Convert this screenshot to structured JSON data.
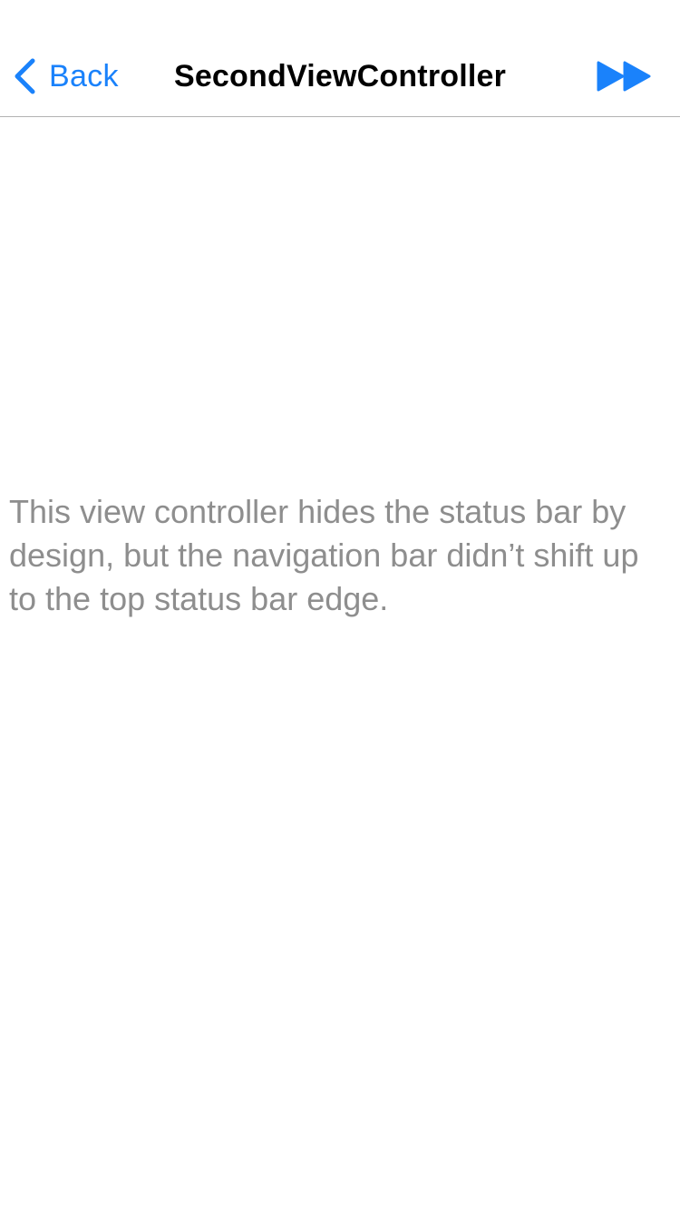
{
  "nav_bar": {
    "back_label": "Back",
    "title": "SecondViewController",
    "back_icon": "chevron-left-icon",
    "forward_icon": "fast-forward-icon",
    "accent_color": "#1a82fb"
  },
  "main": {
    "message": "This view controller hides the status bar by design, but the navigation bar didn’t shift up to the top status bar edge."
  }
}
